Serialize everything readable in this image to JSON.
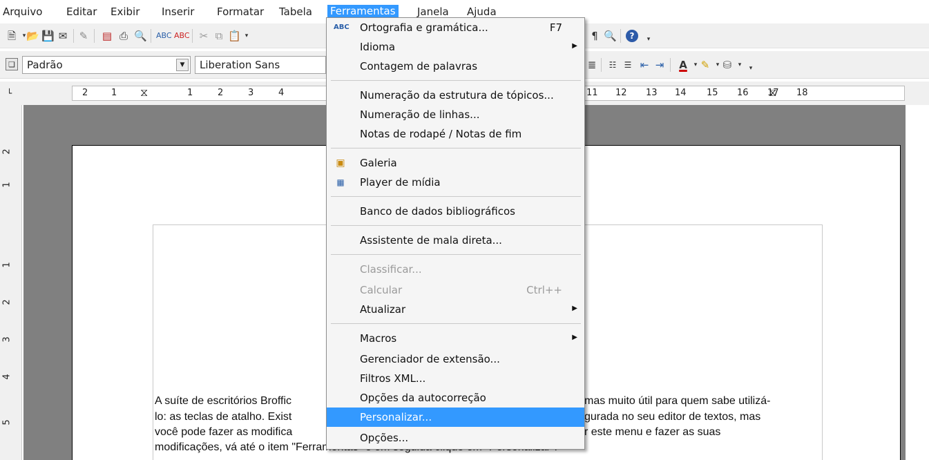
{
  "menubar": {
    "items": [
      "Arquivo",
      "Editar",
      "Exibir",
      "Inserir",
      "Formatar",
      "Tabela",
      "Ferramentas",
      "Janela",
      "Ajuda"
    ],
    "active": "Ferramentas"
  },
  "toolbar2": {
    "paragraph_style": "Padrão",
    "font_name": "Liberation Sans"
  },
  "ruler": {
    "ticks": [
      "2",
      "1",
      "1",
      "2",
      "3",
      "4",
      "11",
      "12",
      "13",
      "14",
      "15",
      "16",
      "17",
      "18"
    ]
  },
  "vruler": {
    "ticks": [
      "2",
      "1",
      "1",
      "2",
      "3",
      "4",
      "5"
    ]
  },
  "menu": {
    "items": [
      {
        "label": "Ortografia e gramática...",
        "shortcut": "F7",
        "icon": "spellcheck-icon"
      },
      {
        "label": "Idioma",
        "submenu": true
      },
      {
        "label": "Contagem de palavras"
      },
      {
        "label": "Numeração da estrutura de tópicos..."
      },
      {
        "label": "Numeração de linhas..."
      },
      {
        "label": "Notas de rodapé / Notas de fim"
      },
      {
        "label": "Galeria",
        "icon": "gallery-icon"
      },
      {
        "label": "Player de mídia",
        "icon": "media-player-icon"
      },
      {
        "label": "Banco de dados bibliográficos"
      },
      {
        "label": "Assistente de mala direta..."
      },
      {
        "label": "Classificar...",
        "disabled": true
      },
      {
        "label": "Calcular",
        "shortcut": "Ctrl++",
        "disabled": true
      },
      {
        "label": "Atualizar",
        "submenu": true
      },
      {
        "label": "Macros",
        "submenu": true
      },
      {
        "label": "Gerenciador de extensão..."
      },
      {
        "label": "Filtros XML..."
      },
      {
        "label": "Opções da autocorreção"
      },
      {
        "label": "Personalizar...",
        "highlighted": true
      },
      {
        "label": "Opções..."
      }
    ]
  },
  "document": {
    "lines": [
      {
        "left": "A suíte de escritórios Broffic",
        "right": "mas muito útil para quem sabe utilizá-"
      },
      {
        "left": "lo: as teclas de atalho. Exist",
        "right": "gurada no seu editor de textos, mas"
      },
      {
        "left": "você pode fazer as modifica",
        "right": "r este menu e fazer as suas"
      },
      {
        "left": "modificações, vá até o item \"Ferramentas\" e em seguida clique em \"Personalizar\":",
        "right": ""
      }
    ]
  },
  "colors": {
    "highlight": "#3399ff",
    "doc_background": "#808080",
    "toolbar": "#f0f0f0"
  }
}
